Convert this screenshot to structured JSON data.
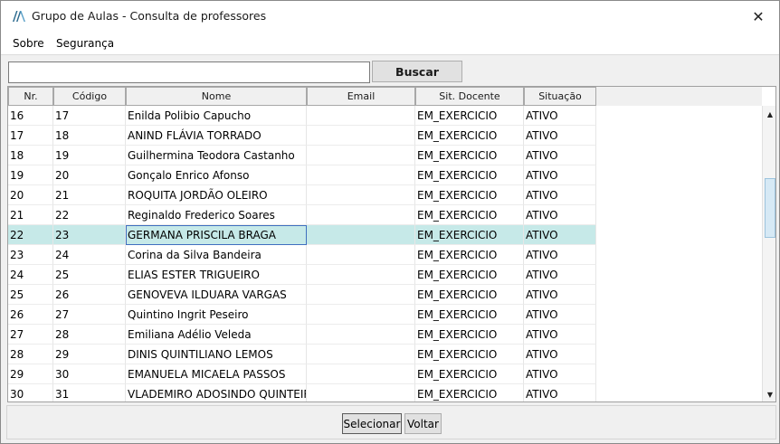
{
  "window": {
    "title": "Grupo de Aulas - Consulta de professores",
    "icon": "app-logo-icon",
    "close_glyph": "✕"
  },
  "menu": {
    "items": [
      "Sobre",
      "Segurança"
    ]
  },
  "search": {
    "value": "",
    "placeholder": "",
    "button_label": "Buscar"
  },
  "table": {
    "columns": [
      "Nr.",
      "Código",
      "Nome",
      "Email",
      "Sit. Docente",
      "Situação"
    ],
    "selected_index": 6,
    "rows": [
      {
        "nr": "16",
        "codigo": "17",
        "nome": "Enilda Polibio Capucho",
        "email": "",
        "sit": "EM_EXERCICIO",
        "situacao": "ATIVO"
      },
      {
        "nr": "17",
        "codigo": "18",
        "nome": "ANIND FLÁVIA TORRADO",
        "email": "",
        "sit": "EM_EXERCICIO",
        "situacao": "ATIVO"
      },
      {
        "nr": "18",
        "codigo": "19",
        "nome": "Guilhermina Teodora Castanho",
        "email": "",
        "sit": "EM_EXERCICIO",
        "situacao": "ATIVO"
      },
      {
        "nr": "19",
        "codigo": "20",
        "nome": "Gonçalo Enrico Afonso",
        "email": "",
        "sit": "EM_EXERCICIO",
        "situacao": "ATIVO"
      },
      {
        "nr": "20",
        "codigo": "21",
        "nome": "ROQUITA JORDÃO OLEIRO",
        "email": "",
        "sit": "EM_EXERCICIO",
        "situacao": "ATIVO"
      },
      {
        "nr": "21",
        "codigo": "22",
        "nome": "Reginaldo Frederico Soares",
        "email": "",
        "sit": "EM_EXERCICIO",
        "situacao": "ATIVO"
      },
      {
        "nr": "22",
        "codigo": "23",
        "nome": "GERMANA PRISCILA BRAGA",
        "email": "",
        "sit": "EM_EXERCICIO",
        "situacao": "ATIVO"
      },
      {
        "nr": "23",
        "codigo": "24",
        "nome": "Corina da Silva Bandeira",
        "email": "",
        "sit": "EM_EXERCICIO",
        "situacao": "ATIVO"
      },
      {
        "nr": "24",
        "codigo": "25",
        "nome": "ELIAS ESTER TRIGUEIRO",
        "email": "",
        "sit": "EM_EXERCICIO",
        "situacao": "ATIVO"
      },
      {
        "nr": "25",
        "codigo": "26",
        "nome": "GENOVEVA ILDUARA VARGAS",
        "email": "",
        "sit": "EM_EXERCICIO",
        "situacao": "ATIVO"
      },
      {
        "nr": "26",
        "codigo": "27",
        "nome": "Quintino Ingrit Peseiro",
        "email": "",
        "sit": "EM_EXERCICIO",
        "situacao": "ATIVO"
      },
      {
        "nr": "27",
        "codigo": "28",
        "nome": "Emiliana Adélio Veleda",
        "email": "",
        "sit": "EM_EXERCICIO",
        "situacao": "ATIVO"
      },
      {
        "nr": "28",
        "codigo": "29",
        "nome": "DINIS QUINTILIANO LEMOS",
        "email": "",
        "sit": "EM_EXERCICIO",
        "situacao": "ATIVO"
      },
      {
        "nr": "29",
        "codigo": "30",
        "nome": "EMANUELA MICAELA PASSOS",
        "email": "",
        "sit": "EM_EXERCICIO",
        "situacao": "ATIVO"
      },
      {
        "nr": "30",
        "codigo": "31",
        "nome": "VLADEMIRO ADOSINDO QUINTEIRO",
        "email": "",
        "sit": "EM_EXERCICIO",
        "situacao": "ATIVO"
      }
    ]
  },
  "scrollbar": {
    "up_glyph": "▲",
    "down_glyph": "▼"
  },
  "footer": {
    "select_label": "Selecionar",
    "back_label": "Voltar"
  },
  "colors": {
    "selected_row": "#c6e9e8",
    "window_bg": "#f0f0f0",
    "scroll_thumb": "#d6e9f5"
  }
}
